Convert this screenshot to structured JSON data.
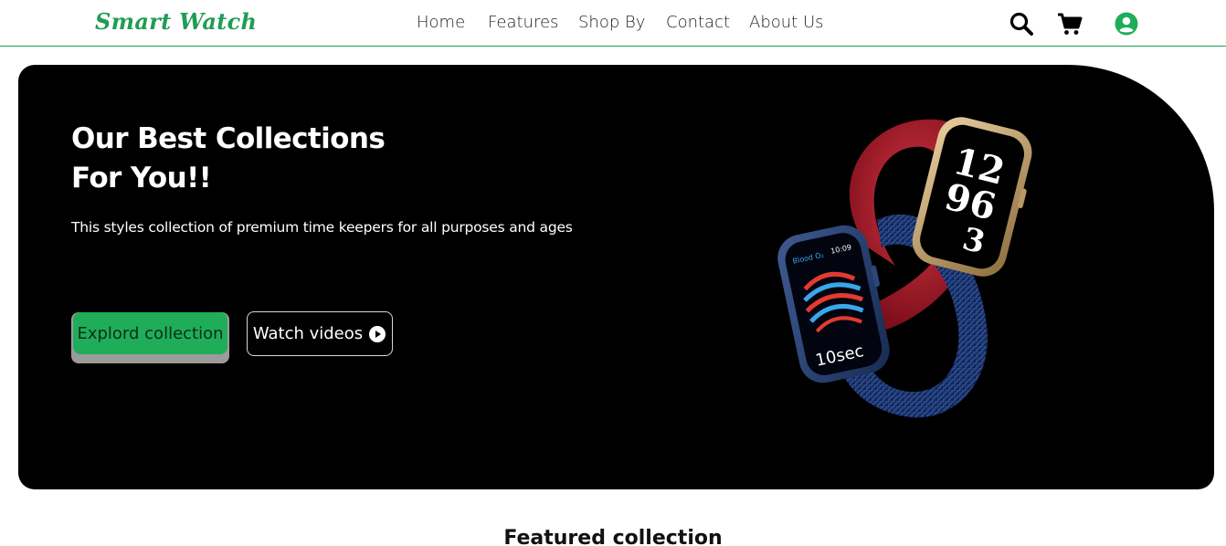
{
  "brand": {
    "name": "Smart Watch",
    "color": "#1f9d55"
  },
  "nav": {
    "links": [
      "Home",
      "Features",
      "Shop By",
      "Contact",
      "About Us"
    ],
    "icons": [
      "search-icon",
      "cart-icon",
      "user-account-icon"
    ]
  },
  "hero": {
    "title_line1": "Our Best Collections",
    "title_line2": "For You!!",
    "subtitle": "This styles collection of premium time keepers for all purposes and ages",
    "primary_button": "Explord collection",
    "secondary_button": "Watch videos",
    "background": "#000000",
    "accent": "#1fad5a",
    "watch_screen": {
      "numbers": "12 9 6 3",
      "readout": "10sec",
      "time": "10:09",
      "label": "Blood O₂"
    }
  },
  "featured": {
    "title": "Featured collection"
  }
}
